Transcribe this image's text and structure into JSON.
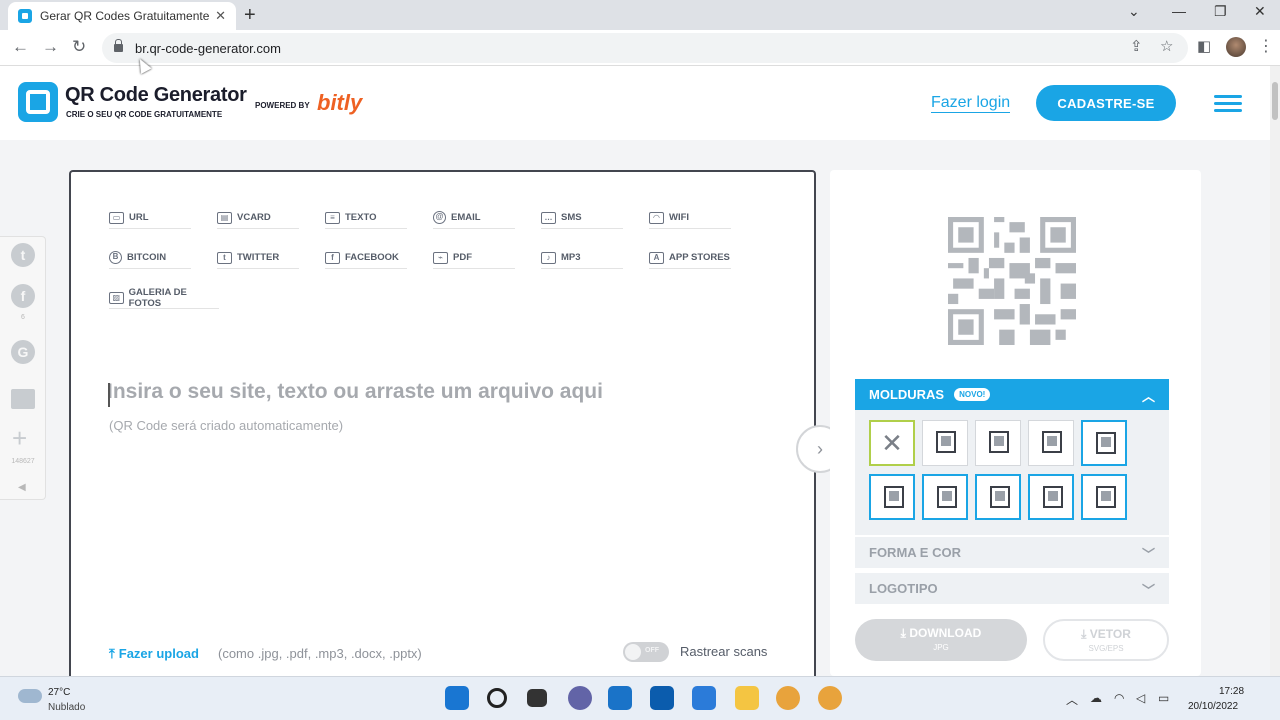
{
  "browser": {
    "tab_title": "Gerar QR Codes Gratuitamente |",
    "tab_close": "✕",
    "new_tab": "+",
    "url": "br.qr-code-generator.com"
  },
  "header": {
    "logo_title": "QR Code Generator",
    "logo_subtitle": "CRIE O SEU QR CODE GRATUITAMENTE",
    "powered_by": "POWERED BY",
    "brand": "bitly",
    "login_label": "Fazer login",
    "signup_label": "CADASTRE-SE"
  },
  "share": {
    "facebook_count": "6",
    "plus_count": "148627"
  },
  "types": [
    {
      "label": "URL",
      "icon": "url-icon",
      "glyph": "▭"
    },
    {
      "label": "VCARD",
      "icon": "vcard-icon",
      "glyph": "▤"
    },
    {
      "label": "TEXTO",
      "icon": "text-icon",
      "glyph": "≡"
    },
    {
      "label": "EMAIL",
      "icon": "email-icon",
      "glyph": "@"
    },
    {
      "label": "SMS",
      "icon": "sms-icon",
      "glyph": "…"
    },
    {
      "label": "WIFI",
      "icon": "wifi-icon",
      "glyph": "◠"
    },
    {
      "label": "BITCOIN",
      "icon": "bitcoin-icon",
      "glyph": "B"
    },
    {
      "label": "TWITTER",
      "icon": "twitter-icon",
      "glyph": "t"
    },
    {
      "label": "FACEBOOK",
      "icon": "facebook-icon",
      "glyph": "f"
    },
    {
      "label": "PDF",
      "icon": "pdf-icon",
      "glyph": "⌁"
    },
    {
      "label": "MP3",
      "icon": "mp3-icon",
      "glyph": "♪"
    },
    {
      "label": "APP STORES",
      "icon": "app-stores-icon",
      "glyph": "A"
    },
    {
      "label": "GALERIA DE FOTOS",
      "icon": "photo-gallery-icon",
      "glyph": "▨"
    }
  ],
  "editor": {
    "placeholder": "Insira o seu site, texto ou arraste um arquivo aqui",
    "hint": "(QR Code será criado automaticamente)",
    "upload_label": "Fazer upload",
    "upload_note": "(como .jpg, .pdf, .mp3, .docx, .pptx)",
    "toggle_label": "OFF",
    "track_label": "Rastrear scans"
  },
  "panel": {
    "frames_title": "MOLDURAS",
    "frames_badge": "NOVO!",
    "shape_color": "FORMA E COR",
    "logo": "LOGOTIPO",
    "download_label": "DOWNLOAD",
    "download_sub": "JPG",
    "vector_label": "VETOR",
    "vector_sub": "SVG/EPS"
  },
  "taskbar": {
    "temperature": "27°C",
    "weather": "Nublado",
    "time": "17:28",
    "date": "20/10/2022"
  },
  "colors": {
    "accent": "#1aa5e5",
    "brand_orange": "#ee6123",
    "frame_selected": "#b0cf4a"
  }
}
